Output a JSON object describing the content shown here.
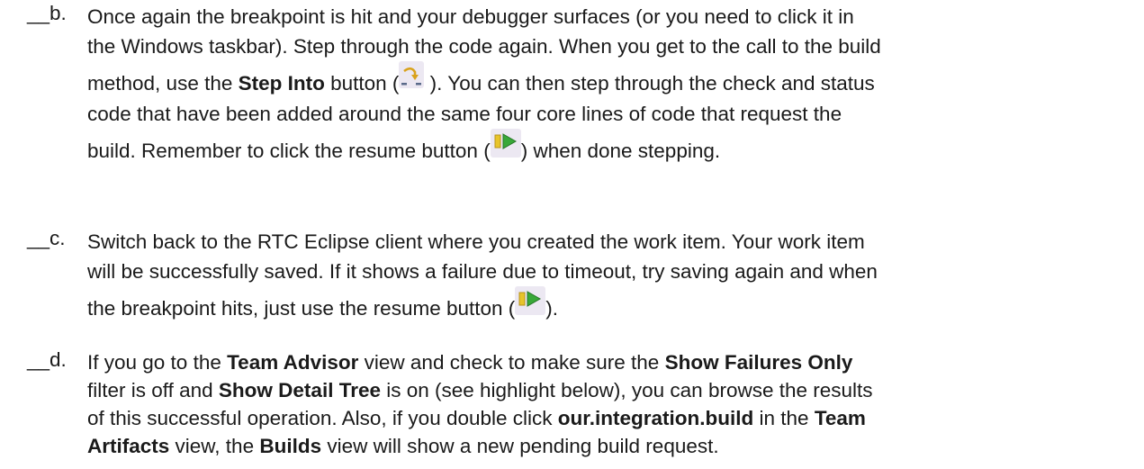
{
  "steps": [
    {
      "label": "__b.",
      "lines": [
        {
          "parts": [
            "Once again the breakpoint is hit and your debugger surfaces (or you need to click it in"
          ]
        },
        {
          "parts": [
            "the Windows taskbar). Step through the code again. When you get to the call to the build"
          ]
        },
        {
          "parts": [
            "method, use the ",
            "Step Into",
            " button (",
            " ). You can then step through the check and status"
          ]
        },
        {
          "parts": [
            "code that have been added around the same four core lines of code that request the"
          ]
        },
        {
          "parts": [
            "build. Remember to click the resume button (",
            ") when done stepping."
          ]
        }
      ]
    },
    {
      "label": "__c.",
      "lines": [
        {
          "parts": [
            "Switch back to the RTC Eclipse client where you created the work item. Your work item"
          ]
        },
        {
          "parts": [
            "will be successfully saved. If it shows a failure due to timeout, try saving again and when"
          ]
        },
        {
          "parts": [
            "the breakpoint hits, just use the resume button (",
            ")."
          ]
        }
      ]
    },
    {
      "label": "__d.",
      "lines": [
        {
          "parts": [
            "If you go to the ",
            "Team Advisor",
            " view and check to make sure the ",
            "Show Failures Only"
          ]
        },
        {
          "parts": [
            "filter is off and ",
            "Show Detail Tree",
            " is on (see highlight below), you can browse the results"
          ]
        },
        {
          "parts": [
            "of this successful operation. Also, if you double click ",
            "our.integration.build",
            " in the ",
            "Team"
          ]
        },
        {
          "parts": [
            "Artifacts",
            " view, the ",
            "Builds",
            " view will show a new pending build request."
          ]
        }
      ]
    }
  ],
  "icons": {
    "step_into": "step-into-icon",
    "resume": "resume-icon",
    "colors": {
      "step_into_arrow": "#d9a21b",
      "resume_bar": "#e8c42a",
      "resume_triangle": "#38a838",
      "icon_bg": "#ece8f2"
    }
  }
}
